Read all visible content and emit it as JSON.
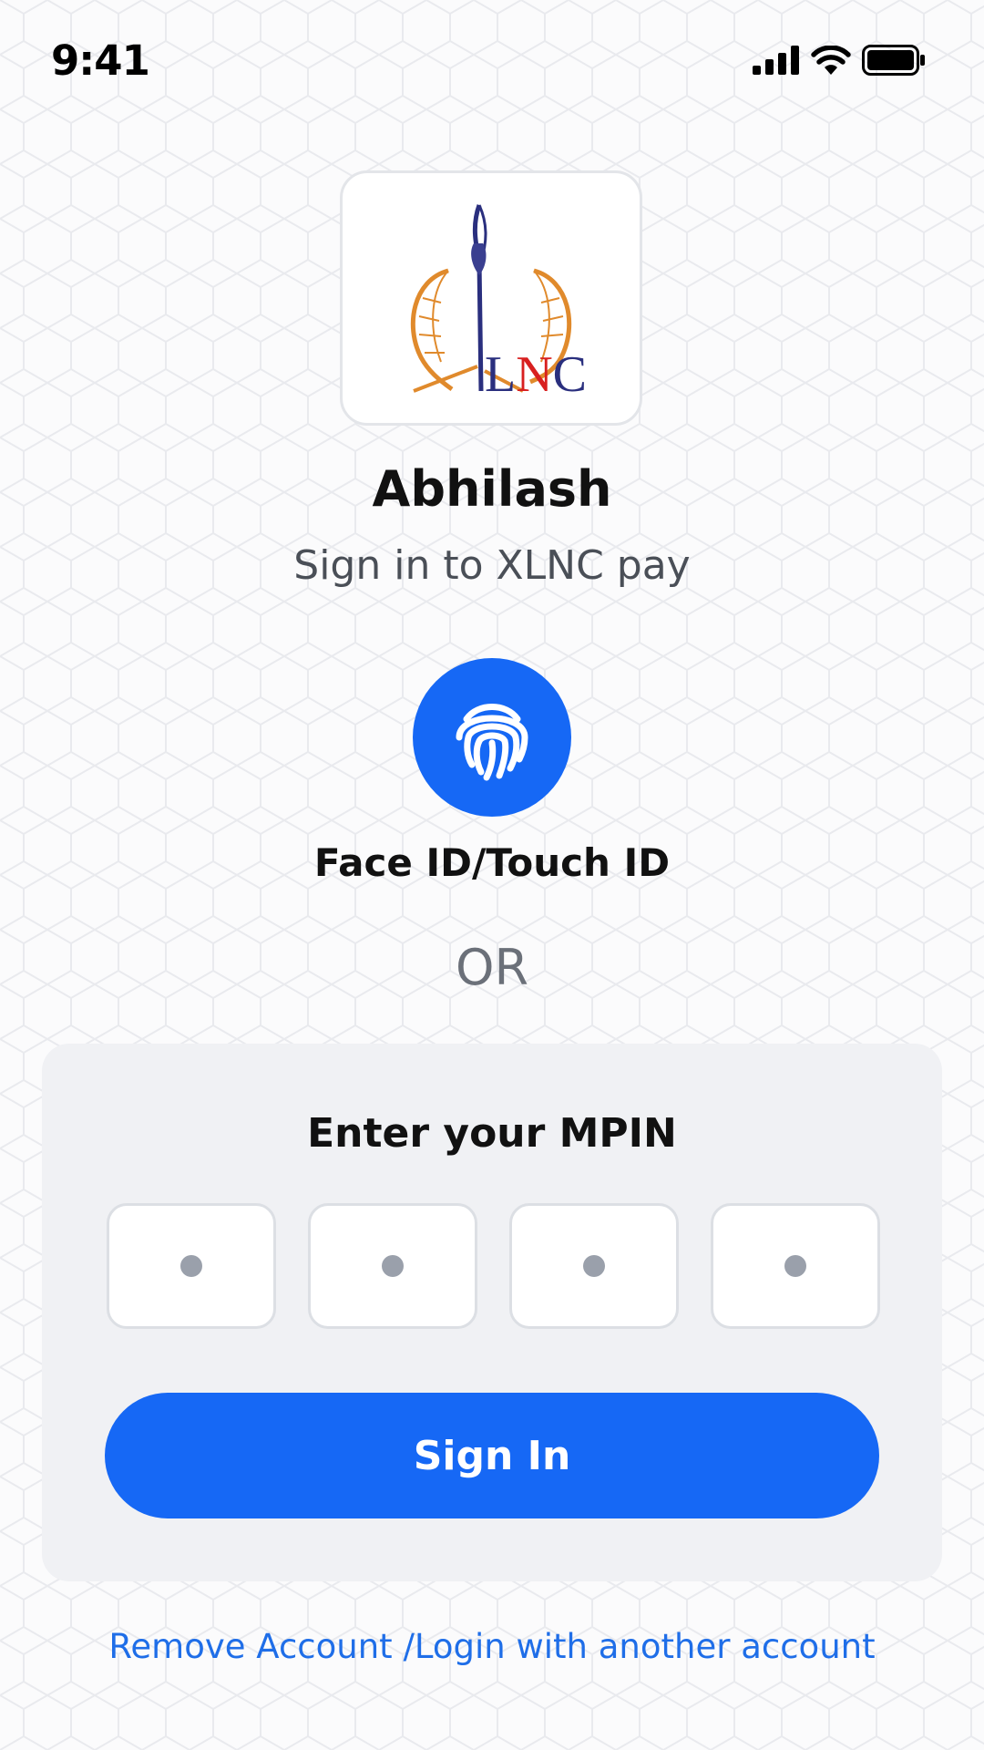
{
  "status_bar": {
    "time": "9:41",
    "icons": [
      "cellular-signal-icon",
      "wifi-icon",
      "battery-icon"
    ]
  },
  "logo": {
    "brand_text": "XLNC",
    "colors": {
      "wings": "#e08a2c",
      "quill": "#2a2f7e",
      "accent": "#d82020"
    }
  },
  "account": {
    "name": "Abhilash",
    "subtitle": "Sign in to XLNC pay"
  },
  "biometric": {
    "icon": "fingerprint-icon",
    "label": "Face ID/Touch ID"
  },
  "divider_text": "OR",
  "mpin": {
    "title": "Enter your MPIN",
    "digits": [
      "•",
      "•",
      "•",
      "•"
    ]
  },
  "signin_label": "Sign In",
  "remove_account_label": "Remove Account /Login with another account",
  "colors": {
    "primary": "#1668f5",
    "link": "#1f6ee8",
    "card_bg": "#f0f1f4"
  }
}
